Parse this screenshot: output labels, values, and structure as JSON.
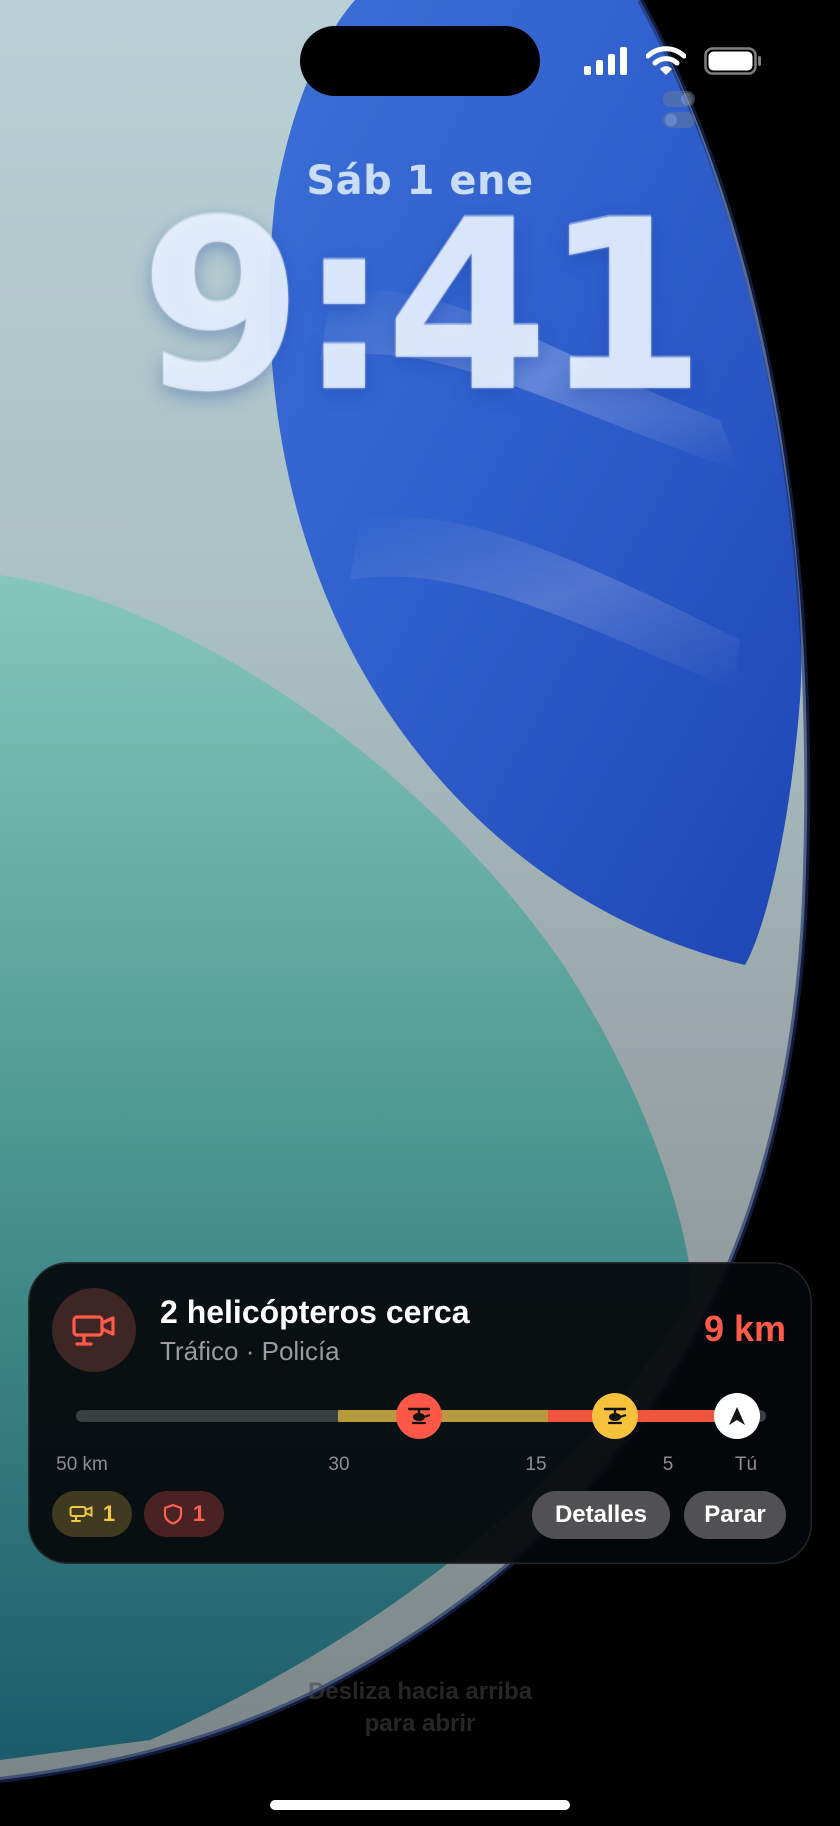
{
  "lockscreen": {
    "date": "Sáb 1 ene",
    "time": "9:41",
    "swipe_line1": "Desliza hacia arriba",
    "swipe_line2": "para abrir"
  },
  "status_bar": {
    "icons": [
      "cellular-signal-icon",
      "wifi-icon",
      "battery-icon",
      "focus-toggle-icon"
    ]
  },
  "live_activity": {
    "icon": "camera-icon",
    "title": "2 helicópteros cerca",
    "subtitle": "Tráfico · Policía",
    "distance": "9 km",
    "scale": {
      "labels": [
        "50 km",
        "30",
        "15",
        "5",
        "Tú"
      ],
      "markers": [
        "helicopter-red-icon",
        "helicopter-yellow-icon",
        "location-arrow-icon"
      ]
    },
    "counts": {
      "camera": "1",
      "police": "1"
    },
    "buttons": {
      "details": "Detalles",
      "stop": "Parar"
    }
  },
  "colors": {
    "accent_red": "#ff5b48",
    "accent_yellow": "#f7c23b",
    "card_bg": "#04080a"
  }
}
